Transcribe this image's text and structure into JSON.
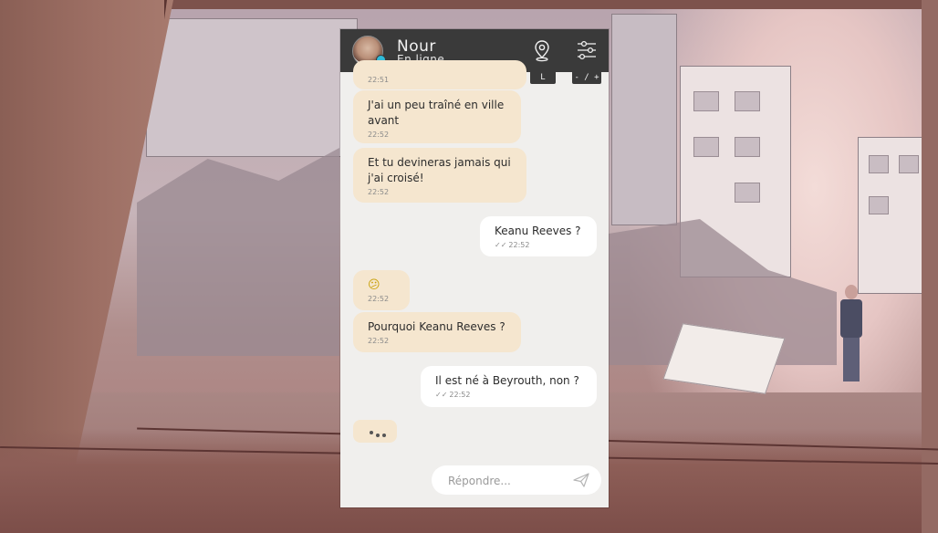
{
  "contact": {
    "name": "Nour",
    "status": "En ligne",
    "status_color": "#2fbbd9"
  },
  "header_controls": {
    "location_icon": "location-pin-icon",
    "settings_icon": "sliders-icon",
    "location_tab": "L",
    "zoom_tab": "- / +"
  },
  "messages": [
    {
      "from": "contact",
      "text": "",
      "time": "22:51"
    },
    {
      "from": "contact",
      "text": "J'ai un peu traîné en ville avant",
      "time": "22:52"
    },
    {
      "from": "contact",
      "text": "Et tu devineras jamais qui j'ai croisé!",
      "time": "22:52"
    },
    {
      "from": "me",
      "text": "Keanu Reeves ?",
      "time": "22:52",
      "ticks": "✓✓"
    },
    {
      "from": "contact",
      "text": "😕",
      "time": "22:52"
    },
    {
      "from": "contact",
      "text": "Pourquoi Keanu Reeves ?",
      "time": "22:52"
    },
    {
      "from": "me",
      "text": "Il est né à Beyrouth, non ?",
      "time": "22:52",
      "ticks": "✓✓"
    }
  ],
  "typing_indicator": "typing-dots",
  "reply": {
    "placeholder": "Répondre...",
    "send_icon": "send-icon"
  },
  "colors": {
    "header": "#3a3a3a",
    "incoming_bubble": "#f5e6cf",
    "outgoing_bubble": "#ffffff",
    "panel": "#f0efed"
  }
}
